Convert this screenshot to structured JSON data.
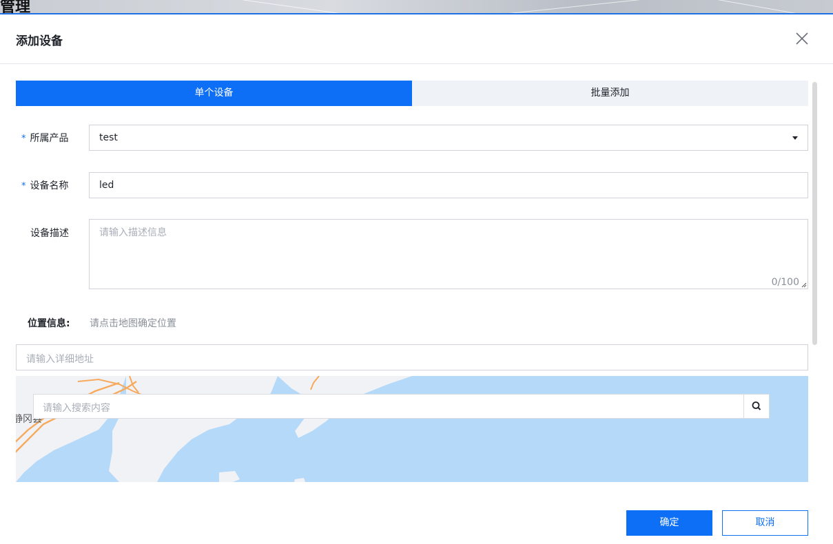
{
  "background": {
    "title": "管理"
  },
  "dialog": {
    "title": "添加设备",
    "tabs": [
      {
        "label": "单个设备",
        "active": true
      },
      {
        "label": "批量添加",
        "active": false
      }
    ],
    "product": {
      "label": "所属产品",
      "required_mark": "*",
      "value": "test"
    },
    "name": {
      "label": "设备名称",
      "required_mark": "*",
      "value": "led"
    },
    "description": {
      "label": "设备描述",
      "placeholder": "请输入描述信息",
      "counter": "0/100"
    },
    "location": {
      "label": "位置信息:",
      "hint": "请点击地图确定位置",
      "address_placeholder": "请输入详细地址"
    },
    "map": {
      "search_placeholder": "请输入搜索内容",
      "place_label": "静冈县"
    },
    "buttons": {
      "confirm": "确定",
      "cancel": "取消"
    },
    "colors": {
      "primary": "#0c6ff5",
      "water": "#b5d9f8",
      "land": "#f1f2f6",
      "road": "#f7a95c"
    }
  }
}
